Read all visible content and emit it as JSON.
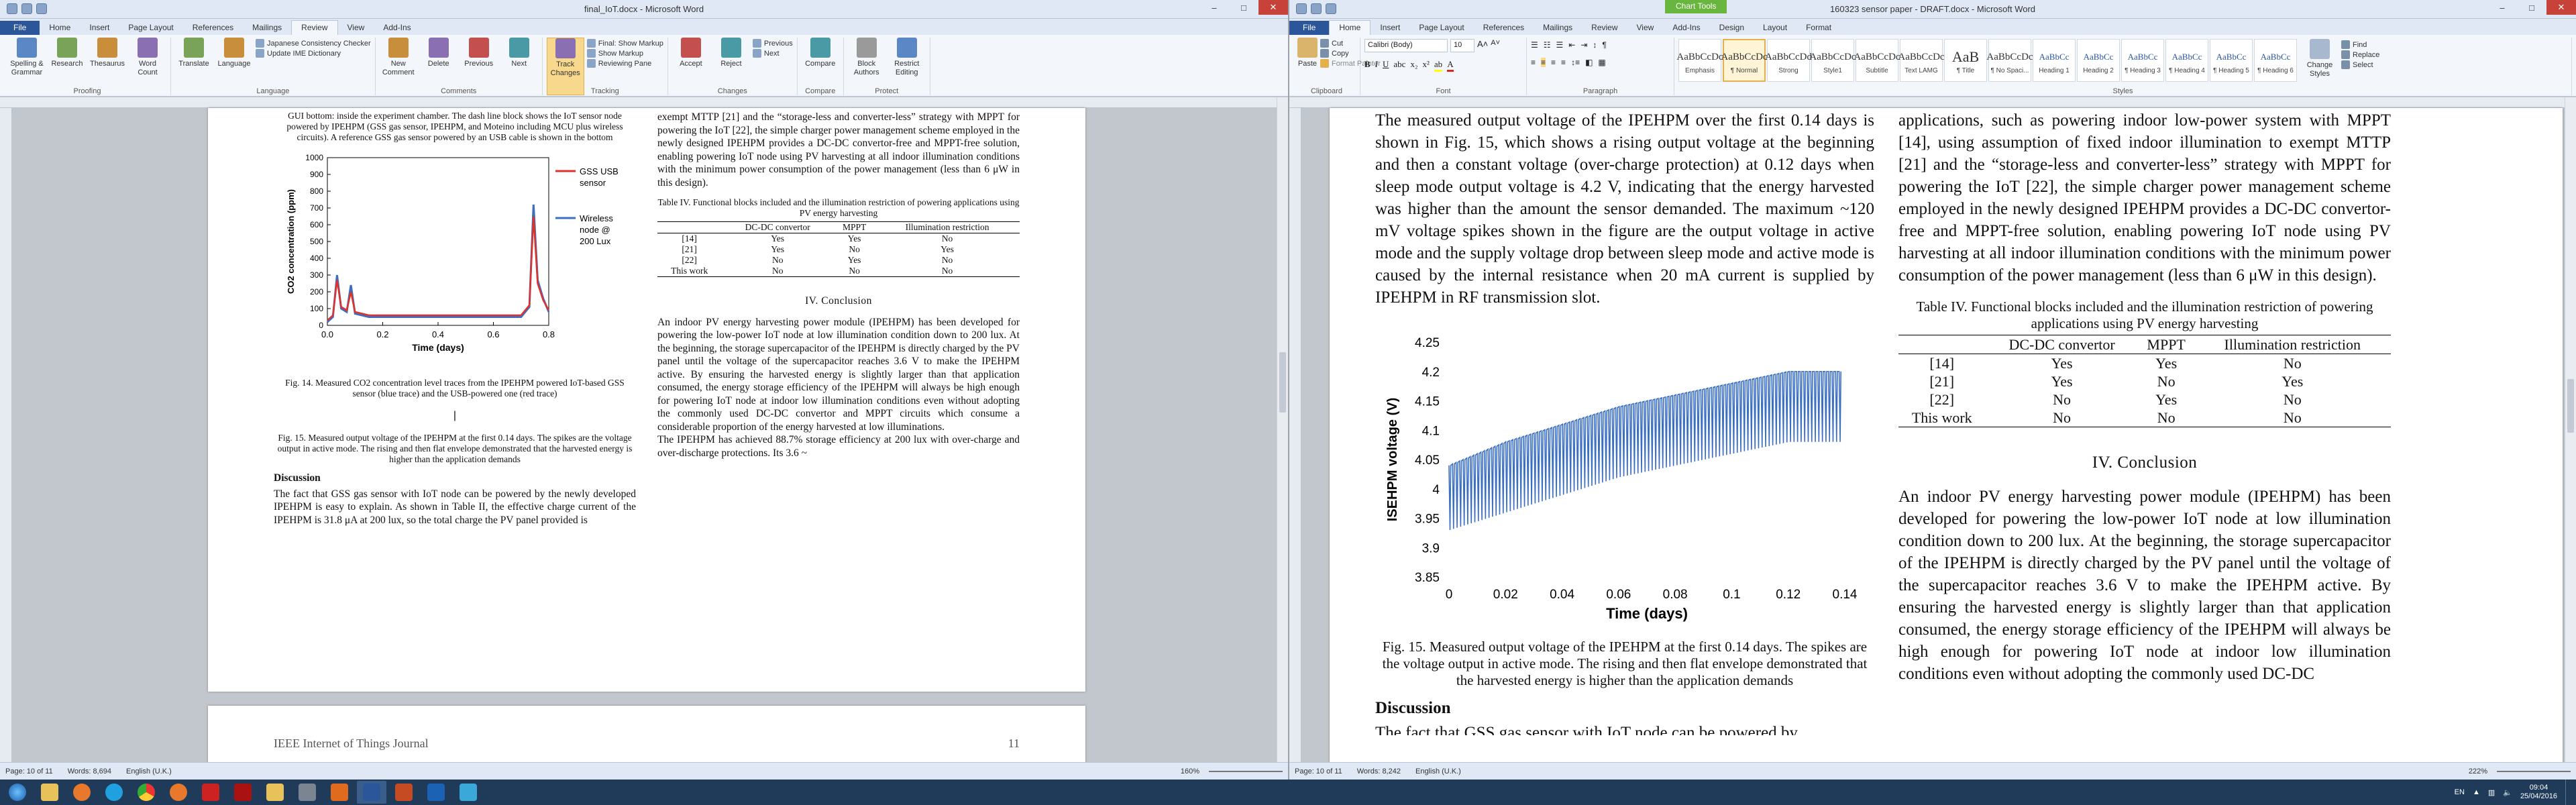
{
  "window1": {
    "title": "final_IoT.docx - Microsoft Word",
    "tabs": [
      "File",
      "Home",
      "Insert",
      "Page Layout",
      "References",
      "Mailings",
      "Review",
      "View",
      "Add-Ins"
    ],
    "active_tab": "Review",
    "ribbon_groups": [
      {
        "label": "Proofing",
        "buttons": [
          "Spelling & Grammar",
          "Research",
          "Thesaurus",
          "Word Count"
        ]
      },
      {
        "label": "Language",
        "buttons": [
          "Translate",
          "Language"
        ],
        "small": [
          "Japanese Consistency Checker",
          "Update IME Dictionary"
        ]
      },
      {
        "label": "Comments",
        "buttons": [
          "New Comment",
          "Delete",
          "Previous",
          "Next"
        ]
      },
      {
        "label": "Tracking",
        "buttons": [
          "Track Changes"
        ],
        "small": [
          "Final: Show Markup",
          "Show Markup",
          "Reviewing Pane"
        ]
      },
      {
        "label": "Changes",
        "buttons": [
          "Accept",
          "Reject"
        ],
        "small": [
          "Previous",
          "Next"
        ]
      },
      {
        "label": "Compare",
        "buttons": [
          "Compare"
        ]
      },
      {
        "label": "Protect",
        "buttons": [
          "Block Authors",
          "Restrict Editing"
        ]
      }
    ],
    "doc": {
      "col1_intro": "GUI bottom: inside the experiment chamber. The dash line block shows the IoT sensor node powered by IPEHPM (GSS gas sensor, IPEHPM, and Moteino including MCU plus wireless circuits). A reference GSS gas sensor powered by an USB cable is shown in the bottom",
      "chart": {
        "ylabel": "CO2 concentration (ppm)",
        "xlabel": "Time (days)",
        "legend": [
          "GSS USB sensor",
          "Wireless node @ 200 Lux"
        ]
      },
      "fig14_caption": "Fig. 14.  Measured CO2 concentration level traces from the IPEHPM powered IoT-based GSS sensor (blue trace) and the USB-powered one (red trace)",
      "fig15_caption": "Fig. 15.  Measured output voltage of the IPEHPM at the first 0.14 days. The spikes are the voltage output in active mode. The rising and then flat envelope demonstrated that the harvested energy is higher than the application demands",
      "discussion_heading": "Discussion",
      "discussion_text": "The fact that GSS gas sensor with IoT node can be powered by the newly developed IPEHPM is easy to explain. As shown in Table II, the effective charge current of the IPEHPM is 31.8 μA at 200 lux, so the total charge the PV panel provided is",
      "col2_intro": "exempt MTTP [21] and the “storage-less and converter-less” strategy with MPPT for powering the IoT [22], the simple charger power management scheme employed in the newly designed IPEHPM provides a DC-DC convertor-free and MPPT-free solution, enabling powering IoT node using PV harvesting at all indoor illumination conditions with the minimum power consumption of the power management (less than 6 μW in this design).",
      "table_caption": "Table IV.  Functional blocks included and the illumination restriction of powering applications using PV energy harvesting",
      "conclusion_heading": "IV.  Conclusion",
      "conclusion_text": "An indoor PV energy harvesting power module (IPEHPM) has been developed for powering the low-power IoT node at low illumination condition down to 200 lux. At the beginning, the storage supercapacitor of the IPEHPM is directly charged by the PV panel until the voltage of the supercapacitor reaches 3.6 V to make the IPEHPM active. By ensuring the harvested energy is slightly larger than that application consumed, the energy storage efficiency of the IPEHPM will always be high enough for powering IoT node at indoor low illumination conditions even without adopting the commonly used DC-DC convertor and MPPT circuits which consume a considerable proportion of the energy harvested at low illuminations.",
      "conclusion_text2": "The IPEHPM has achieved 88.7% storage efficiency at 200 lux with over-charge and over-discharge protections. Its 3.6 ~",
      "footer_journal": "IEEE Internet of Things Journal",
      "footer_page": "11"
    },
    "status": {
      "page": "Page: 10 of 11",
      "words": "Words: 8,694",
      "lang": "English (U.K.)",
      "zoom": "160%"
    }
  },
  "window2": {
    "title": "160323 sensor paper - DRAFT.docx - Microsoft Word",
    "context_tab": "Chart Tools",
    "tabs": [
      "File",
      "Home",
      "Insert",
      "Page Layout",
      "References",
      "Mailings",
      "Review",
      "View",
      "Add-Ins",
      "Design",
      "Layout",
      "Format"
    ],
    "active_tab": "Home",
    "font": {
      "name": "Calibri (Body)",
      "size": "10"
    },
    "ribbon_groups": [
      "Clipboard",
      "Font",
      "Paragraph",
      "Styles"
    ],
    "clipboard": [
      "Paste",
      "Cut",
      "Copy",
      "Format Painter"
    ],
    "styles": [
      {
        "sample": "AaBbCcDc",
        "name": "Emphasis"
      },
      {
        "sample": "AaBbCcDc",
        "name": "¶ Normal"
      },
      {
        "sample": "AaBbCcDd",
        "name": "Strong"
      },
      {
        "sample": "AaBbCcDc",
        "name": "Style1"
      },
      {
        "sample": "AaBbCcDc",
        "name": "Subtitle"
      },
      {
        "sample": "AaBbCcDc",
        "name": "Text LAMG"
      },
      {
        "sample": "AaB",
        "name": "¶ Title"
      },
      {
        "sample": "AaBbCcDc",
        "name": "¶ No Spaci..."
      },
      {
        "sample": "AaBbCc",
        "name": "Heading 1"
      },
      {
        "sample": "AaBbCc",
        "name": "Heading 2"
      },
      {
        "sample": "AaBbCc",
        "name": "¶ Heading 3"
      },
      {
        "sample": "AaBbCc",
        "name": "¶ Heading 4"
      },
      {
        "sample": "AaBbCc",
        "name": "¶ Heading 5"
      },
      {
        "sample": "AaBbCc",
        "name": "¶ Heading 6"
      }
    ],
    "editing": [
      "Change Styles",
      "Find",
      "Replace",
      "Select"
    ],
    "doc": {
      "col1_para": "The measured output voltage of the IPEHPM over the first 0.14 days is shown in Fig. 15, which shows a rising output voltage at the beginning and then a constant voltage (over-charge protection) at 0.12 days when sleep mode output voltage is 4.2 V, indicating that the energy harvested was higher than the amount the sensor demanded. The maximum ~120 mV voltage spikes shown in the figure are the output voltage in active mode and the supply voltage drop between sleep mode and active mode is caused by the internal resistance when 20 mA current is supplied by IPEHPM in RF transmission slot.",
      "fig15_caption": "Fig. 15.  Measured output voltage of the IPEHPM at the first 0.14 days. The spikes are the voltage output in active mode. The rising and then flat envelope demonstrated that the harvested energy is higher than the application demands",
      "discussion_heading": "Discussion",
      "discussion_partial": "The fact that GSS gas sensor with IoT node can be powered by",
      "col2_intro": "applications, such as powering indoor low-power system with MPPT [14], using assumption of fixed indoor illumination to exempt MTTP [21] and the “storage-less and converter-less” strategy with MPPT for powering the IoT [22], the simple charger power management scheme employed in the newly designed IPEHPM provides a DC-DC convertor-free and MPPT-free solution, enabling powering IoT node using PV harvesting at all indoor illumination conditions with the minimum power consumption of the power management (less than 6 μW in this design).",
      "table_caption": "Table IV.  Functional blocks included and the illumination restriction of powering applications using PV energy harvesting",
      "conclusion_heading": "IV.  Conclusion",
      "conclusion_text": "An indoor PV energy harvesting power module (IPEHPM) has been developed for powering the low-power IoT node at low illumination condition down to 200 lux. At the beginning, the storage supercapacitor of the IPEHPM is directly charged by the PV panel until the voltage of the supercapacitor reaches 3.6 V to make the IPEHPM active. By ensuring the harvested energy is slightly larger than that application consumed, the energy storage efficiency of the IPEHPM will always be high enough for powering IoT node at indoor low illumination conditions even without adopting the commonly used DC-DC"
    },
    "status": {
      "page": "Page: 10 of 11",
      "words": "Words: 8,242",
      "lang": "English (U.K.)",
      "zoom": "222%"
    }
  },
  "table_iv": {
    "headers": [
      "",
      "DC-DC convertor",
      "MPPT",
      "Illumination restriction"
    ],
    "rows": [
      [
        "[14]",
        "Yes",
        "Yes",
        "No"
      ],
      [
        "[21]",
        "Yes",
        "No",
        "Yes"
      ],
      [
        "[22]",
        "No",
        "Yes",
        "No"
      ],
      [
        "This work",
        "No",
        "No",
        "No"
      ]
    ]
  },
  "chart_data": [
    {
      "type": "line",
      "title": "",
      "xlabel": "Time (days)",
      "ylabel": "CO2 concentration (ppm)",
      "xlim": [
        0.0,
        0.8
      ],
      "ylim": [
        0,
        1000
      ],
      "x_ticks": [
        "0.0",
        "0.2",
        "0.4",
        "0.6",
        "0.8"
      ],
      "y_ticks": [
        "0",
        "100",
        "200",
        "300",
        "400",
        "500",
        "600",
        "700",
        "800",
        "900",
        "1000"
      ],
      "legend_position": "right",
      "series": [
        {
          "name": "GSS USB sensor",
          "color": "#e0312b",
          "x": [
            0,
            0.02,
            0.035,
            0.05,
            0.07,
            0.085,
            0.1,
            0.15,
            0.3,
            0.5,
            0.7,
            0.73,
            0.745,
            0.76,
            0.78,
            0.8
          ],
          "values": [
            30,
            60,
            270,
            110,
            90,
            200,
            80,
            60,
            60,
            60,
            60,
            120,
            650,
            250,
            150,
            90
          ]
        },
        {
          "name": "Wireless node @ 200 Lux",
          "color": "#3b6fc4",
          "x": [
            0,
            0.02,
            0.035,
            0.05,
            0.07,
            0.085,
            0.1,
            0.15,
            0.3,
            0.5,
            0.7,
            0.73,
            0.745,
            0.76,
            0.78,
            0.8
          ],
          "values": [
            20,
            50,
            300,
            100,
            80,
            240,
            70,
            50,
            50,
            50,
            50,
            110,
            720,
            270,
            160,
            80
          ]
        }
      ]
    },
    {
      "type": "line",
      "title": "",
      "xlabel": "Time (days)",
      "ylabel": "ISEHPM voltage (V)",
      "xlim": [
        0,
        0.14
      ],
      "ylim": [
        3.85,
        4.25
      ],
      "x_ticks": [
        "0",
        "0.02",
        "0.04",
        "0.06",
        "0.08",
        "0.1",
        "0.12",
        "0.14"
      ],
      "y_ticks": [
        "3.85",
        "3.9",
        "3.95",
        "4",
        "4.05",
        "4.1",
        "4.15",
        "4.2",
        "4.25"
      ],
      "grid": false,
      "series": [
        {
          "name": "",
          "color": "#3b6fc4",
          "x": [
            0,
            0.02,
            0.04,
            0.06,
            0.08,
            0.1,
            0.12,
            0.138
          ],
          "envelope_top": [
            4.04,
            4.08,
            4.11,
            4.14,
            4.16,
            4.18,
            4.2,
            4.2
          ],
          "envelope_bottom": [
            3.93,
            3.96,
            3.99,
            4.02,
            4.04,
            4.06,
            4.08,
            4.08
          ]
        }
      ]
    }
  ]
}
